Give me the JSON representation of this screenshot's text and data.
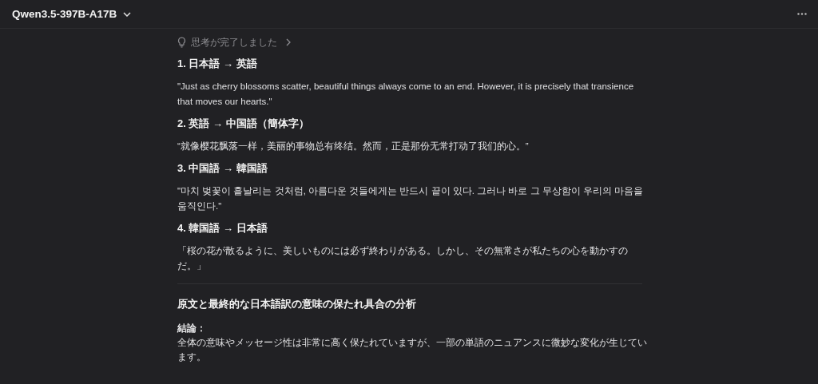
{
  "header": {
    "model_name": "Qwen3.5-397B-A17B"
  },
  "thinking": {
    "label": "思考が完了しました",
    "expanded": false
  },
  "steps": [
    {
      "heading": "1. 日本語 → 英語",
      "text": "\"Just as cherry blossoms scatter, beautiful things always come to an end. However, it is precisely that transience that moves our hearts.\""
    },
    {
      "heading": "2. 英語 → 中国語（簡体字）",
      "text": "“就像樱花飘落一样，美丽的事物总有终结。然而，正是那份无常打动了我们的心。”"
    },
    {
      "heading": "3. 中国語 → 韓国語",
      "text": "\"마치 벚꽃이 흩날리는 것처럼, 아름다운 것들에게는 반드시 끝이 있다. 그러나 바로 그 무상함이 우리의 마음을 움직인다.\""
    },
    {
      "heading": "4. 韓国語 → 日本語",
      "text": "「桜の花が散るように、美しいものには必ず終わりがある。しかし、その無常さが私たちの心を動かすのだ。」"
    }
  ],
  "analysis": {
    "heading": "原文と最終的な日本語訳の意味の保たれ具合の分析",
    "label": "結論：",
    "text": "全体の意味やメッセージ性は非常に高く保たれていますが、一部の単語のニュアンスに微妙な変化が生じています。"
  }
}
